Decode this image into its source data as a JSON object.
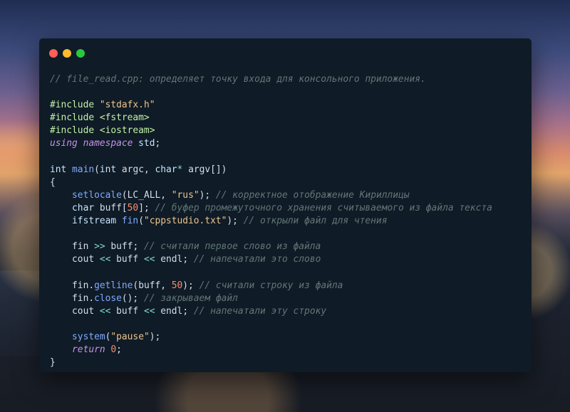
{
  "window": {
    "controls": [
      "close",
      "minimize",
      "maximize"
    ],
    "colors": {
      "background": "#0f1b26",
      "close": "#ff5f57",
      "minimize": "#febc2e",
      "maximize": "#28c840"
    }
  },
  "code": {
    "language": "cpp",
    "lines": [
      [
        [
          "comment",
          "// file_read.cpp: определяет точку входа для консольного приложения."
        ]
      ],
      [],
      [
        [
          "directive",
          "#include "
        ],
        [
          "string",
          "\"stdafx.h\""
        ]
      ],
      [
        [
          "directive",
          "#include <fstream>"
        ]
      ],
      [
        [
          "directive",
          "#include <iostream>"
        ]
      ],
      [
        [
          "keyword",
          "using namespace"
        ],
        [
          "type",
          " std"
        ],
        [
          "punct",
          ";"
        ]
      ],
      [],
      [
        [
          "type",
          "int "
        ],
        [
          "func",
          "main"
        ],
        [
          "punct",
          "("
        ],
        [
          "type",
          "int"
        ],
        [
          "ident",
          " argc"
        ],
        [
          "punct",
          ", "
        ],
        [
          "type",
          "char"
        ],
        [
          "op",
          "*"
        ],
        [
          "ident",
          " argv"
        ],
        [
          "punct",
          "[])"
        ]
      ],
      [
        [
          "punct",
          "{"
        ]
      ],
      [
        [
          "ident",
          "    "
        ],
        [
          "func",
          "setlocale"
        ],
        [
          "punct",
          "("
        ],
        [
          "ident",
          "LC_ALL"
        ],
        [
          "punct",
          ", "
        ],
        [
          "string",
          "\"rus\""
        ],
        [
          "punct",
          "); "
        ],
        [
          "comment",
          "// корректное отображение Кириллицы"
        ]
      ],
      [
        [
          "ident",
          "    "
        ],
        [
          "type",
          "char"
        ],
        [
          "ident",
          " buff"
        ],
        [
          "punct",
          "["
        ],
        [
          "number",
          "50"
        ],
        [
          "punct",
          "]; "
        ],
        [
          "comment",
          "// буфер промежуточного хранения считываемого из файла текста"
        ]
      ],
      [
        [
          "ident",
          "    "
        ],
        [
          "type",
          "ifstream"
        ],
        [
          "func",
          " fin"
        ],
        [
          "punct",
          "("
        ],
        [
          "string",
          "\"cppstudio.txt\""
        ],
        [
          "punct",
          "); "
        ],
        [
          "comment",
          "// открыли файл для чтения"
        ]
      ],
      [],
      [
        [
          "ident",
          "    fin "
        ],
        [
          "op",
          ">>"
        ],
        [
          "ident",
          " buff"
        ],
        [
          "punct",
          "; "
        ],
        [
          "comment",
          "// считали первое слово из файла"
        ]
      ],
      [
        [
          "ident",
          "    cout "
        ],
        [
          "op",
          "<<"
        ],
        [
          "ident",
          " buff "
        ],
        [
          "op",
          "<<"
        ],
        [
          "ident",
          " endl"
        ],
        [
          "punct",
          "; "
        ],
        [
          "comment",
          "// напечатали это слово"
        ]
      ],
      [],
      [
        [
          "ident",
          "    fin"
        ],
        [
          "punct",
          "."
        ],
        [
          "func",
          "getline"
        ],
        [
          "punct",
          "("
        ],
        [
          "ident",
          "buff"
        ],
        [
          "punct",
          ", "
        ],
        [
          "number",
          "50"
        ],
        [
          "punct",
          "); "
        ],
        [
          "comment",
          "// считали строку из файла"
        ]
      ],
      [
        [
          "ident",
          "    fin"
        ],
        [
          "punct",
          "."
        ],
        [
          "func",
          "close"
        ],
        [
          "punct",
          "(); "
        ],
        [
          "comment",
          "// закрываем файл"
        ]
      ],
      [
        [
          "ident",
          "    cout "
        ],
        [
          "op",
          "<<"
        ],
        [
          "ident",
          " buff "
        ],
        [
          "op",
          "<<"
        ],
        [
          "ident",
          " endl"
        ],
        [
          "punct",
          "; "
        ],
        [
          "comment",
          "// напечатали эту строку"
        ]
      ],
      [],
      [
        [
          "ident",
          "    "
        ],
        [
          "func",
          "system"
        ],
        [
          "punct",
          "("
        ],
        [
          "string",
          "\"pause\""
        ],
        [
          "punct",
          ");"
        ]
      ],
      [
        [
          "ident",
          "    "
        ],
        [
          "keyword",
          "return"
        ],
        [
          "ident",
          " "
        ],
        [
          "number",
          "0"
        ],
        [
          "punct",
          ";"
        ]
      ],
      [
        [
          "punct",
          "}"
        ]
      ]
    ]
  }
}
